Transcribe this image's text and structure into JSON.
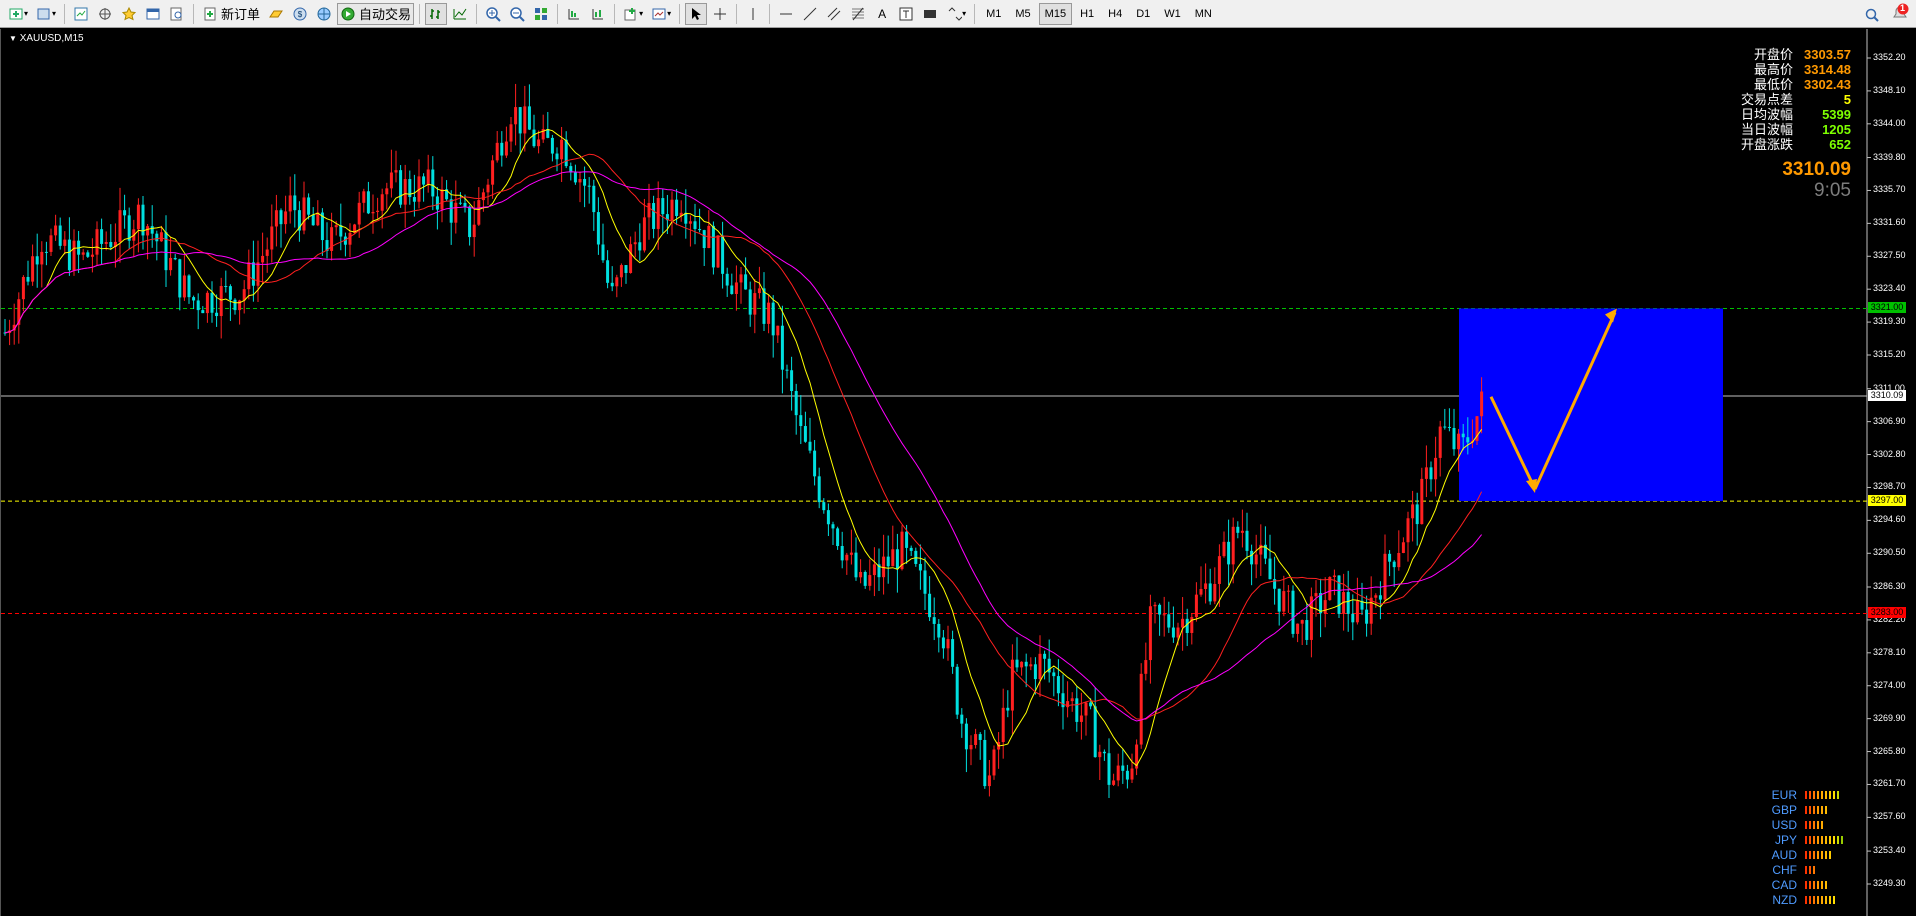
{
  "toolbar": {
    "new_order_label": "新订单",
    "auto_trading_label": "自动交易",
    "timeframes": [
      "M1",
      "M5",
      "M15",
      "H1",
      "H4",
      "D1",
      "W1",
      "MN"
    ],
    "notification_count": "1"
  },
  "chart": {
    "symbol": "XAUUSD,M15",
    "current_price": "3310.09",
    "time_left": "9:05",
    "info": [
      {
        "label": "开盘价",
        "value": "3303.57",
        "color": "#ff9900"
      },
      {
        "label": "最高价",
        "value": "3314.48",
        "color": "#ff9900"
      },
      {
        "label": "最低价",
        "value": "3302.43",
        "color": "#ff9900"
      },
      {
        "label": "交易点差",
        "value": "5",
        "color": "#ffff00"
      },
      {
        "label": "日均波幅",
        "value": "5399",
        "color": "#7fff00"
      },
      {
        "label": "当日波幅",
        "value": "1205",
        "color": "#7fff00"
      },
      {
        "label": "开盘涨跌",
        "value": "652",
        "color": "#7fff00"
      }
    ],
    "price_axis": [
      "3352.20",
      "3348.10",
      "3344.00",
      "3339.80",
      "3335.70",
      "3331.60",
      "3327.50",
      "3323.40",
      "3319.30",
      "3315.20",
      "3311.00",
      "3306.90",
      "3302.80",
      "3298.70",
      "3294.60",
      "3290.50",
      "3286.30",
      "3282.20",
      "3278.10",
      "3274.00",
      "3269.90",
      "3265.80",
      "3261.70",
      "3257.60",
      "3253.40",
      "3249.30"
    ],
    "price_tags": [
      {
        "text": "3321.00",
        "color": "#00c000",
        "textColor": "#000"
      },
      {
        "text": "3310.09",
        "color": "#ffffff",
        "textColor": "#000"
      },
      {
        "text": "3297.00",
        "color": "#ffff00",
        "textColor": "#000"
      },
      {
        "text": "3283.00",
        "color": "#ff0000",
        "textColor": "#000"
      }
    ],
    "currencies": [
      {
        "name": "EUR",
        "strength": 9
      },
      {
        "name": "GBP",
        "strength": 6
      },
      {
        "name": "USD",
        "strength": 5
      },
      {
        "name": "JPY",
        "strength": 10
      },
      {
        "name": "AUD",
        "strength": 7
      },
      {
        "name": "CHF",
        "strength": 3
      },
      {
        "name": "CAD",
        "strength": 6
      },
      {
        "name": "NZD",
        "strength": 8
      }
    ],
    "colors": {
      "bull": "#ff2020",
      "bear": "#00e0e0",
      "ma_fast": "#ffff00",
      "ma_mid": "#ff2020",
      "ma_slow": "#ff00ff",
      "box": "#0000ff",
      "arrow": "#ffaa00"
    }
  }
}
